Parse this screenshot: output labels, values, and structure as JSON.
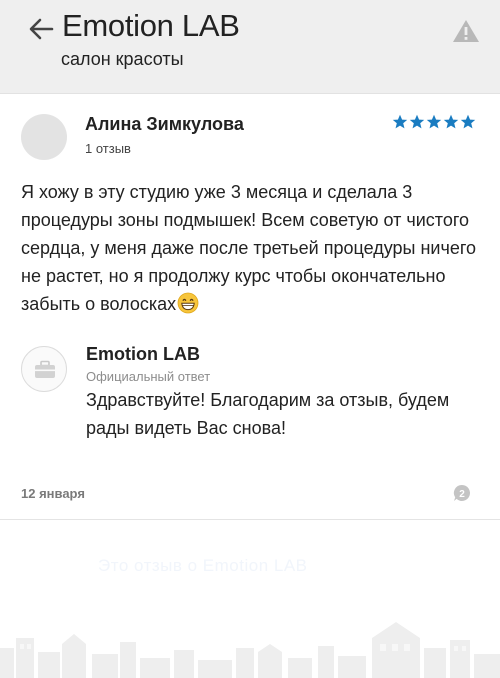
{
  "header": {
    "title": "Emotion LAB",
    "subtitle": "салон красоты",
    "back_icon": "arrow-left-icon",
    "report_icon": "warning-icon"
  },
  "review": {
    "author_name": "Алина Зимкулова",
    "review_count": "1 отзыв",
    "rating": 5,
    "rating_max": 5,
    "star_color": "#1a7cc1",
    "text": "Я хожу в эту студию уже 3 месяца и сделала 3 процедуры зоны подмышек! Всем советую от чистого сердца, у меня даже после третьей процедуры ничего не растет, но я продолжу курс чтобы окончательно забыть о волосках",
    "emoji": "grinning-face-emoji",
    "date": "12 января",
    "comments_count": "2"
  },
  "reply": {
    "author_name": "Emotion LAB",
    "label": "Официальный ответ",
    "text": "Здравствуйте! Благодарим за отзыв, будем рады видеть Вас снова!",
    "avatar_icon": "briefcase-icon"
  },
  "footer": {
    "faded_text": "Это отзыв о Emotion LAB"
  }
}
